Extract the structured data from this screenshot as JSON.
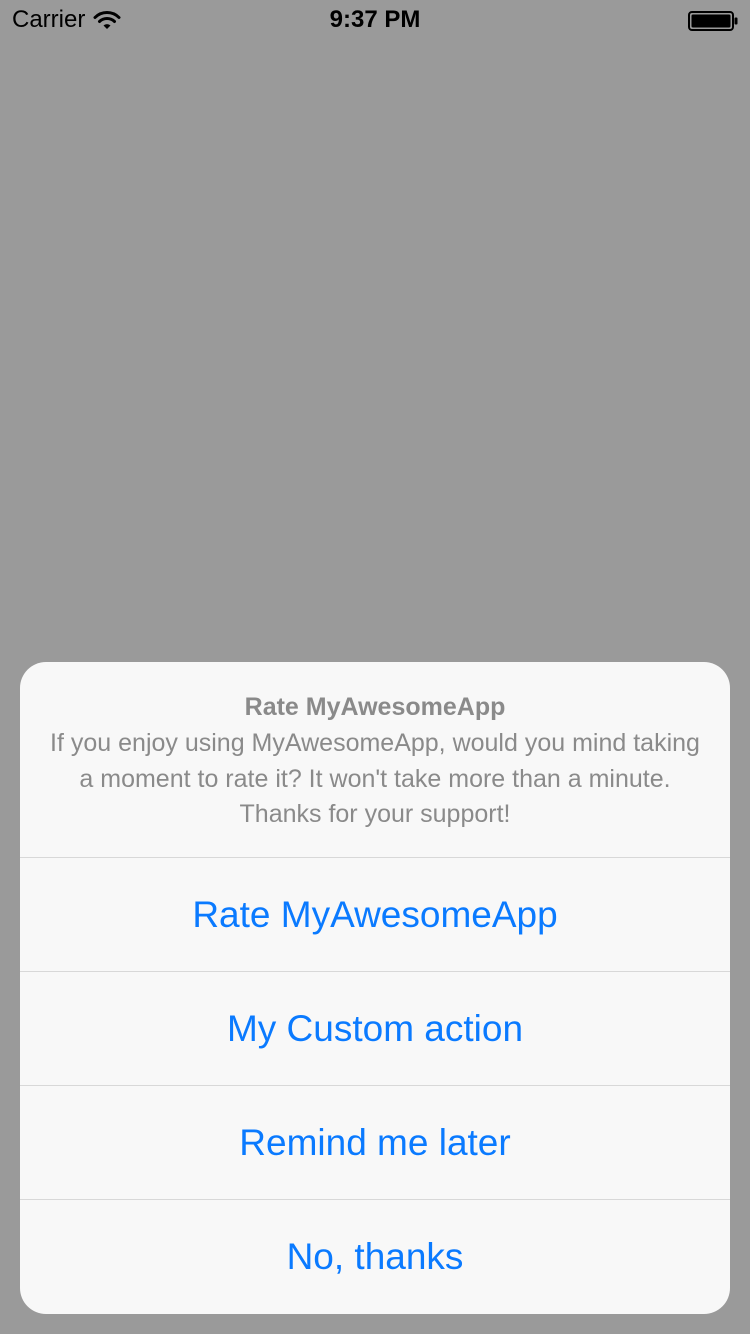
{
  "status_bar": {
    "carrier": "Carrier",
    "time": "9:37 PM",
    "wifi_icon": "wifi-icon",
    "battery_icon": "battery-icon"
  },
  "action_sheet": {
    "title": "Rate MyAwesomeApp",
    "message": "If you enjoy using MyAwesomeApp, would you mind taking a moment to rate it? It won't take more than a minute. Thanks for your support!",
    "actions": [
      {
        "label": "Rate MyAwesomeApp"
      },
      {
        "label": "My Custom action"
      },
      {
        "label": "Remind me later"
      },
      {
        "label": "No, thanks"
      }
    ]
  },
  "colors": {
    "background_dim": "#9a9a9a",
    "sheet_background": "#f8f8f8",
    "action_text": "#0a7aff",
    "secondary_text": "#8a8a8a",
    "separator": "#d8d8d8"
  }
}
